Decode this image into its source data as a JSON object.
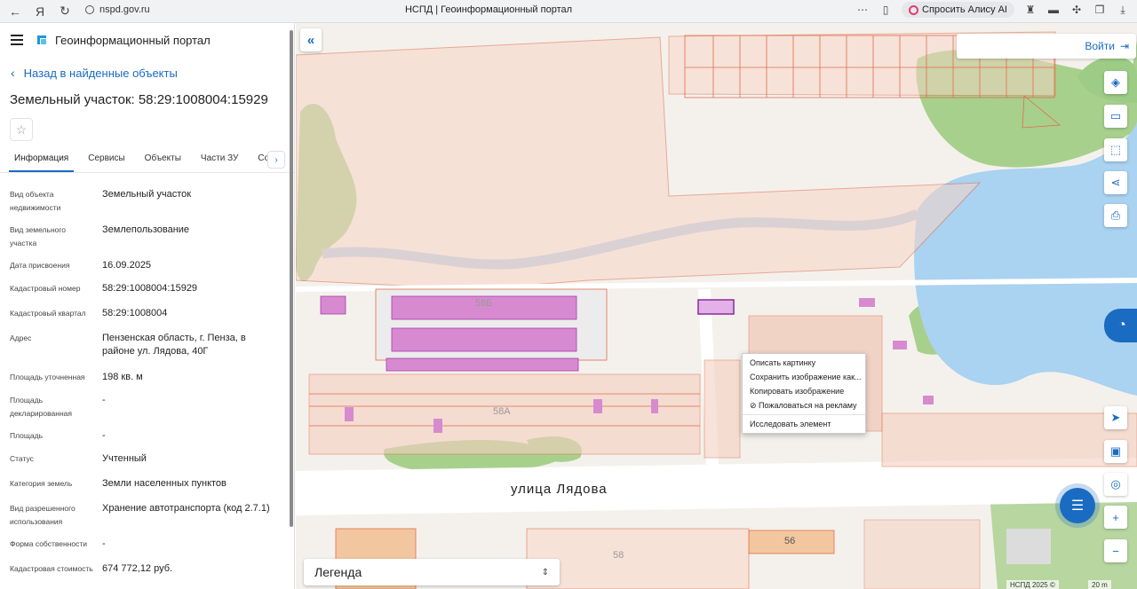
{
  "browser": {
    "url": "nspd.gov.ru",
    "tab_title": "НСПД | Геоинформационный портал",
    "alice_label": "Спросить Алису AI"
  },
  "panel": {
    "app_name": "Геоинформационный портал",
    "back_link": "Назад в найденные объекты",
    "title": "Земельный участок: 58:29:1008004:15929",
    "tabs": [
      "Информация",
      "Сервисы",
      "Объекты",
      "Части ЗУ",
      "Соста"
    ],
    "properties": [
      {
        "key": "Вид объекта недвижимости",
        "value": "Земельный участок"
      },
      {
        "key": "Вид земельного участка",
        "value": "Землепользование"
      },
      {
        "key": "Дата присвоения",
        "value": "16.09.2025"
      },
      {
        "key": "Кадастровый номер",
        "value": "58:29:1008004:15929"
      },
      {
        "key": "Кадастровый квартал",
        "value": "58:29:1008004"
      },
      {
        "key": "Адрес",
        "value": "Пензенская область, г. Пенза, в районе ул. Лядова, 40Г"
      },
      {
        "key": "Площадь уточненная",
        "value": "198 кв. м"
      },
      {
        "key": "Площадь декларированная",
        "value": "-"
      },
      {
        "key": "Площадь",
        "value": "-"
      },
      {
        "key": "Статус",
        "value": "Учтенный"
      },
      {
        "key": "Категория земель",
        "value": "Земли населенных пунктов"
      },
      {
        "key": "Вид разрешенного использования",
        "value": "Хранение автотранспорта (код 2.7.1)"
      },
      {
        "key": "Форма собственности",
        "value": "-"
      },
      {
        "key": "Кадастровая стоимость",
        "value": "674 772,12 руб."
      }
    ]
  },
  "map": {
    "login_label": "Войти",
    "street_label": "улица Лядова",
    "labels": [
      "58Б",
      "58А",
      "58",
      "56"
    ],
    "legend_label": "Легенда",
    "copyright": "НСПД 2025 ©",
    "scale": "20 m",
    "context_menu": [
      "Описать картинку",
      "Сохранить изображение как...",
      "Копировать изображение",
      "Пожаловаться на рекламу",
      "Исследовать элемент"
    ]
  }
}
